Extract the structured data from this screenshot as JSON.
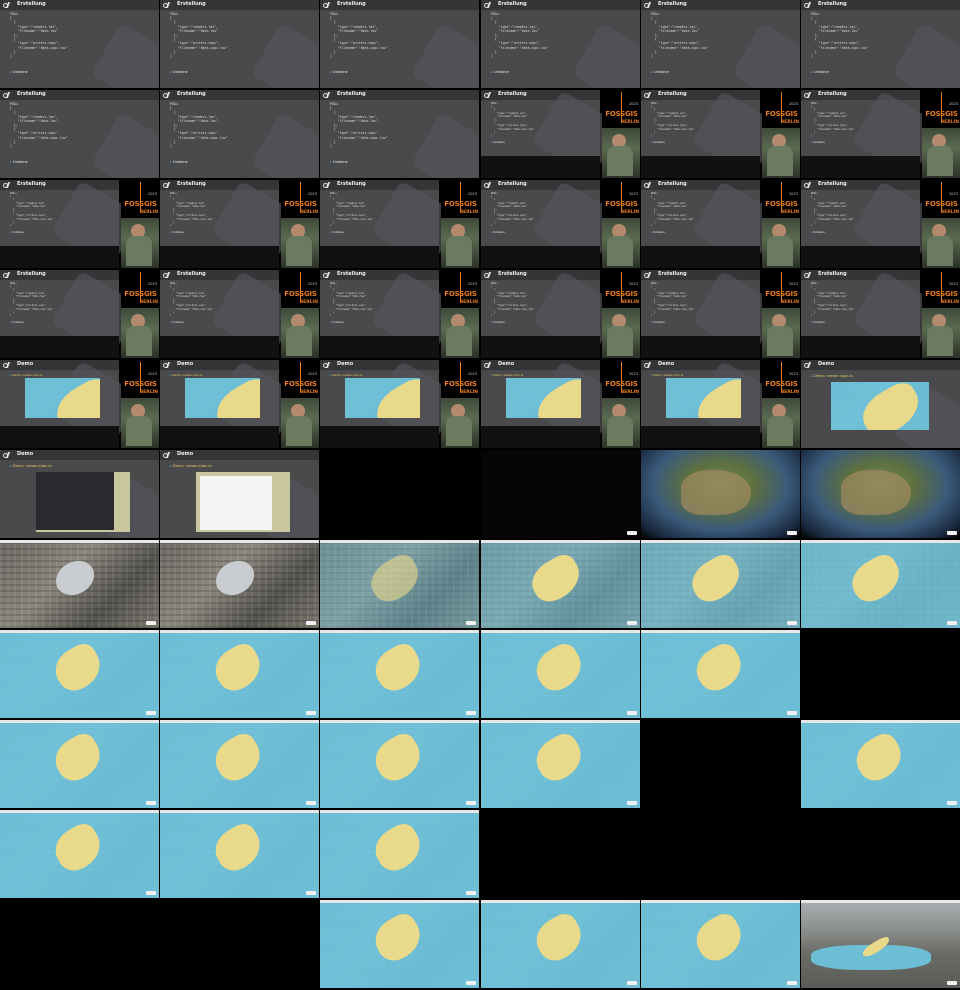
{
  "slides": {
    "erstellung": {
      "title": "Erstellung",
      "code_label": "PDAL:",
      "code": "[\n  {\n    \"type\":\"readers.las\",\n    \"filename\":\"data.las\"\n  },\n  {\n    \"type\":\"writers.copc\",\n    \"filename\":\"data.copc.laz\"\n  }\n]",
      "bullet": "Untwine"
    },
    "demo": {
      "title": "Demo",
      "bullet": "Demo: viewer.copc.io"
    }
  },
  "fossgis": {
    "brand": "FOSSGIS",
    "city": "BERLIN",
    "year": "2023"
  },
  "colors": {
    "slide_bg": "#4a4a4d",
    "fossgis_orange": "#e77b1e",
    "water": "#6ec8e1",
    "sand": "#e9d98b"
  }
}
